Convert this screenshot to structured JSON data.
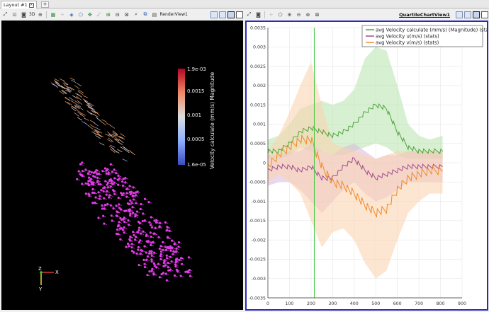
{
  "tabbar": {
    "tab_label": "Layout #1",
    "close_glyph": "×",
    "add_glyph": "+"
  },
  "left_toolbar": {
    "buttons": [
      "reset-camera-icon",
      "zoom-to-data-icon",
      "camera-icon"
    ],
    "mode_label": "3D",
    "view_label": "RenderView1"
  },
  "right_toolbar": {
    "view_label": "QuartileChartView1"
  },
  "render_view": {
    "colorbar": {
      "title": "Velocity calculate (mm/s) Magnitude",
      "max_label": "1.9e-03",
      "min_label": "1.6e-05",
      "tick_labels": [
        "0.0015",
        "0.001",
        "0.0005"
      ],
      "colors": [
        "#b40426",
        "#f08a64",
        "#dddddd",
        "#8db0fe",
        "#3b4cc0"
      ]
    },
    "axes": {
      "x_label": "X",
      "y_label": "Y",
      "z_label": "Z"
    },
    "glyph_color": "#e23be6"
  },
  "chart_data": {
    "type": "line",
    "xlim": [
      0,
      900
    ],
    "ylim": [
      -0.0035,
      0.0035
    ],
    "x_ticks": [
      0,
      100,
      200,
      300,
      400,
      500,
      600,
      700,
      800,
      900
    ],
    "y_ticks": [
      "0.0035",
      "0.003",
      "0.0025",
      "0.002",
      "0.0015",
      "0.001",
      "0.0005",
      "0",
      "-0.0005",
      "-0.001",
      "-0.0015",
      "-0.002",
      "-0.0025",
      "-0.003",
      "-0.0035"
    ],
    "grid": true,
    "legend_position": "top-right",
    "marker_line_x": 215,
    "series": [
      {
        "name": "avg Velocity calculate (mm/s) (Magnitude) (stats)",
        "color": "#4fa33c",
        "band_color": "#b7e3ad",
        "x": [
          0,
          50,
          100,
          150,
          200,
          250,
          300,
          350,
          400,
          450,
          500,
          550,
          600,
          650,
          700,
          750,
          810
        ],
        "y": [
          0.0003,
          0.0003,
          0.0005,
          0.0008,
          0.0009,
          0.0008,
          0.0007,
          0.0008,
          0.001,
          0.0013,
          0.0015,
          0.0014,
          0.0008,
          0.0004,
          0.0003,
          0.0003,
          0.0003
        ],
        "band_low": [
          0.0001,
          0.0001,
          0.0002,
          0.0004,
          0.0003,
          0.0003,
          0.0002,
          0.0002,
          0.0003,
          0.0004,
          0.0005,
          0.0004,
          0.0002,
          0.0001,
          0.0001,
          0.0001,
          0.0001
        ],
        "band_high": [
          0.0006,
          0.0007,
          0.001,
          0.0014,
          0.0015,
          0.0016,
          0.0015,
          0.0016,
          0.0019,
          0.0027,
          0.003,
          0.0029,
          0.002,
          0.001,
          0.0007,
          0.0006,
          0.0007
        ]
      },
      {
        "name": "avg Velocity u(m/s) (stats)",
        "color": "#a04c8c",
        "band_color": "#d9b9dc",
        "x": [
          0,
          50,
          100,
          150,
          200,
          250,
          300,
          350,
          400,
          450,
          500,
          550,
          600,
          650,
          700,
          750,
          810
        ],
        "y": [
          -0.0002,
          -0.0001,
          -0.0001,
          -0.0002,
          -0.0001,
          -0.0004,
          -0.0004,
          -0.0001,
          0.0001,
          -0.0002,
          -0.0004,
          -0.0003,
          -0.0002,
          -0.0001,
          -0.0001,
          -0.0001,
          -0.0001
        ],
        "band_low": [
          -0.0006,
          -0.0005,
          -0.0005,
          -0.0007,
          -0.001,
          -0.0013,
          -0.001,
          -0.0007,
          -0.0005,
          -0.0008,
          -0.001,
          -0.0009,
          -0.0007,
          -0.0005,
          -0.0005,
          -0.0005,
          -0.0005
        ],
        "band_high": [
          0.0002,
          0.0002,
          0.0003,
          0.0003,
          0.0005,
          0.0003,
          0.0002,
          0.0004,
          0.0005,
          0.0003,
          0.0001,
          0.0002,
          0.0002,
          0.0003,
          0.0003,
          0.0003,
          0.0003
        ]
      },
      {
        "name": "avg Velocity v(m/s) (stats)",
        "color": "#f08a28",
        "band_color": "#fbd2ac",
        "x": [
          0,
          50,
          100,
          150,
          200,
          250,
          300,
          350,
          400,
          450,
          500,
          550,
          600,
          650,
          700,
          750,
          810
        ],
        "y": [
          -0.0001,
          0.0002,
          0.0004,
          0.0006,
          0.0006,
          -0.0001,
          -0.0005,
          -0.0006,
          -0.0008,
          -0.0011,
          -0.0013,
          -0.0012,
          -0.0007,
          -0.0004,
          -0.0003,
          -0.0002,
          -0.0002
        ],
        "band_low": [
          -0.0005,
          -0.0003,
          -0.0005,
          -0.0008,
          -0.0015,
          -0.0022,
          -0.0018,
          -0.0017,
          -0.002,
          -0.0026,
          -0.003,
          -0.0028,
          -0.002,
          -0.0013,
          -0.001,
          -0.0008,
          -0.0008
        ],
        "band_high": [
          0.0003,
          0.0007,
          0.0013,
          0.002,
          0.0026,
          0.0015,
          0.0005,
          0.0004,
          0.0003,
          0.0002,
          0.0001,
          0.0002,
          0.0003,
          0.0003,
          0.0003,
          0.0003,
          0.0003
        ]
      }
    ]
  }
}
